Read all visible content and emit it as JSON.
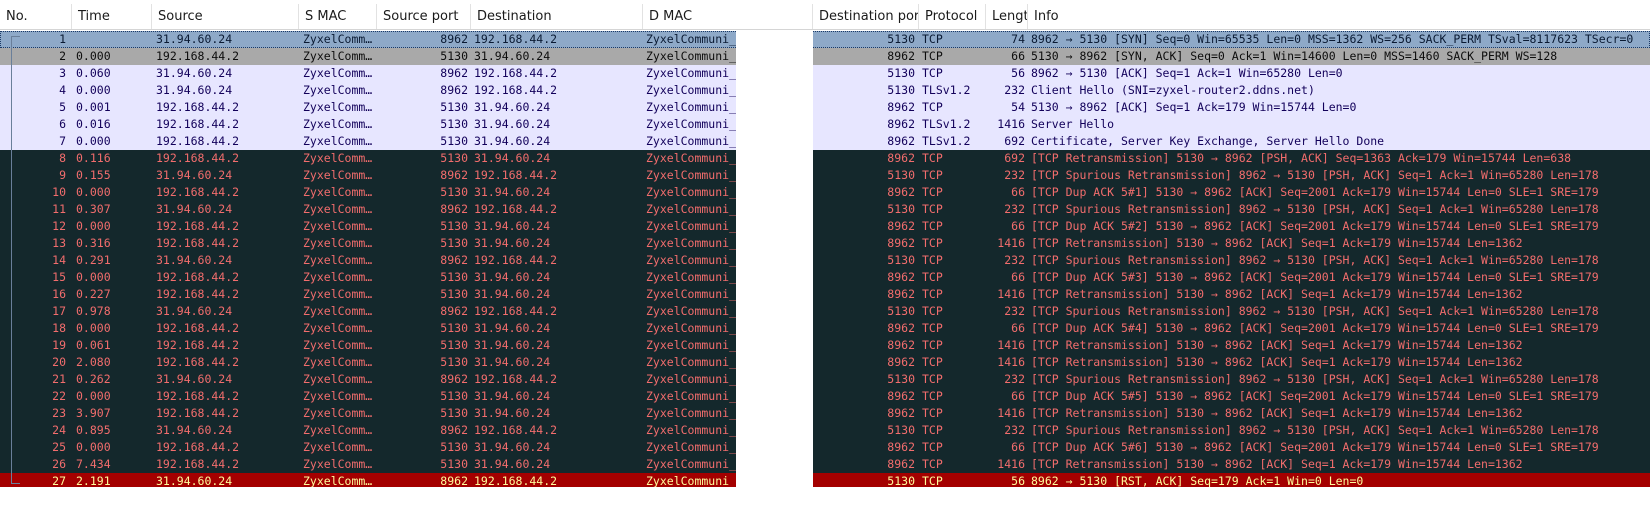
{
  "columns": [
    "No.",
    "Time",
    "Source",
    "S MAC",
    "Source port",
    "Destination",
    "D MAC",
    "Destination port",
    "Protocol",
    "Lengtl",
    "Info"
  ],
  "colors": {
    "selected_bg": "#8ea9c8",
    "selected_fg": "#0a1a33",
    "gray_bg": "#a9a9a9",
    "gray_fg": "#0d0d0d",
    "light_bg": "#e7e6ff",
    "light_fg": "#12005a",
    "dark_bg": "#14282c",
    "dark_fg": "#f26d6d",
    "rst_bg": "#a40000",
    "rst_fg": "#fffc9c"
  },
  "packets": [
    {
      "no": "1",
      "time": "",
      "src": "31.94.60.24",
      "smac": "ZyxelComm…",
      "sport": "8962",
      "dst": "192.168.44.2",
      "dmac": "ZyxelCommuni_",
      "dport": "5130",
      "proto": "TCP",
      "len": "74",
      "info": "8962 → 5130 [SYN] Seq=0 Win=65535 Len=0 MSS=1362 WS=256 SACK_PERM TSval=8117623 TSecr=0",
      "style": "selected"
    },
    {
      "no": "2",
      "time": "0.000",
      "src": "192.168.44.2",
      "smac": "ZyxelComm…",
      "sport": "5130",
      "dst": "31.94.60.24",
      "dmac": "ZyxelCommuni_",
      "dport": "8962",
      "proto": "TCP",
      "len": "66",
      "info": "5130 → 8962 [SYN, ACK] Seq=0 Ack=1 Win=14600 Len=0 MSS=1460 SACK_PERM WS=128",
      "style": "gray"
    },
    {
      "no": "3",
      "time": "0.060",
      "src": "31.94.60.24",
      "smac": "ZyxelComm…",
      "sport": "8962",
      "dst": "192.168.44.2",
      "dmac": "ZyxelCommuni_",
      "dport": "5130",
      "proto": "TCP",
      "len": "56",
      "info": "8962 → 5130 [ACK] Seq=1 Ack=1 Win=65280 Len=0",
      "style": "light"
    },
    {
      "no": "4",
      "time": "0.000",
      "src": "31.94.60.24",
      "smac": "ZyxelComm…",
      "sport": "8962",
      "dst": "192.168.44.2",
      "dmac": "ZyxelCommuni_",
      "dport": "5130",
      "proto": "TLSv1.2",
      "len": "232",
      "info": "Client Hello (SNI=zyxel-router2.ddns.net)",
      "style": "light"
    },
    {
      "no": "5",
      "time": "0.001",
      "src": "192.168.44.2",
      "smac": "ZyxelComm…",
      "sport": "5130",
      "dst": "31.94.60.24",
      "dmac": "ZyxelCommuni_",
      "dport": "8962",
      "proto": "TCP",
      "len": "54",
      "info": "5130 → 8962 [ACK] Seq=1 Ack=179 Win=15744 Len=0",
      "style": "light"
    },
    {
      "no": "6",
      "time": "0.016",
      "src": "192.168.44.2",
      "smac": "ZyxelComm…",
      "sport": "5130",
      "dst": "31.94.60.24",
      "dmac": "ZyxelCommuni_",
      "dport": "8962",
      "proto": "TLSv1.2",
      "len": "1416",
      "info": "Server Hello",
      "style": "light"
    },
    {
      "no": "7",
      "time": "0.000",
      "src": "192.168.44.2",
      "smac": "ZyxelComm…",
      "sport": "5130",
      "dst": "31.94.60.24",
      "dmac": "ZyxelCommuni_",
      "dport": "8962",
      "proto": "TLSv1.2",
      "len": "692",
      "info": "Certificate, Server Key Exchange, Server Hello Done",
      "style": "light"
    },
    {
      "no": "8",
      "time": "0.116",
      "src": "192.168.44.2",
      "smac": "ZyxelComm…",
      "sport": "5130",
      "dst": "31.94.60.24",
      "dmac": "ZyxelCommuni_",
      "dport": "8962",
      "proto": "TCP",
      "len": "692",
      "info": "[TCP Retransmission] 5130 → 8962 [PSH, ACK] Seq=1363 Ack=179 Win=15744 Len=638",
      "style": "dark"
    },
    {
      "no": "9",
      "time": "0.155",
      "src": "31.94.60.24",
      "smac": "ZyxelComm…",
      "sport": "8962",
      "dst": "192.168.44.2",
      "dmac": "ZyxelCommuni_",
      "dport": "5130",
      "proto": "TCP",
      "len": "232",
      "info": "[TCP Spurious Retransmission] 8962 → 5130 [PSH, ACK] Seq=1 Ack=1 Win=65280 Len=178",
      "style": "dark"
    },
    {
      "no": "10",
      "time": "0.000",
      "src": "192.168.44.2",
      "smac": "ZyxelComm…",
      "sport": "5130",
      "dst": "31.94.60.24",
      "dmac": "ZyxelCommuni_",
      "dport": "8962",
      "proto": "TCP",
      "len": "66",
      "info": "[TCP Dup ACK 5#1] 5130 → 8962 [ACK] Seq=2001 Ack=179 Win=15744 Len=0 SLE=1 SRE=179",
      "style": "dark"
    },
    {
      "no": "11",
      "time": "0.307",
      "src": "31.94.60.24",
      "smac": "ZyxelComm…",
      "sport": "8962",
      "dst": "192.168.44.2",
      "dmac": "ZyxelCommuni_",
      "dport": "5130",
      "proto": "TCP",
      "len": "232",
      "info": "[TCP Spurious Retransmission] 8962 → 5130 [PSH, ACK] Seq=1 Ack=1 Win=65280 Len=178",
      "style": "dark"
    },
    {
      "no": "12",
      "time": "0.000",
      "src": "192.168.44.2",
      "smac": "ZyxelComm…",
      "sport": "5130",
      "dst": "31.94.60.24",
      "dmac": "ZyxelCommuni_",
      "dport": "8962",
      "proto": "TCP",
      "len": "66",
      "info": "[TCP Dup ACK 5#2] 5130 → 8962 [ACK] Seq=2001 Ack=179 Win=15744 Len=0 SLE=1 SRE=179",
      "style": "dark"
    },
    {
      "no": "13",
      "time": "0.316",
      "src": "192.168.44.2",
      "smac": "ZyxelComm…",
      "sport": "5130",
      "dst": "31.94.60.24",
      "dmac": "ZyxelCommuni_",
      "dport": "8962",
      "proto": "TCP",
      "len": "1416",
      "info": "[TCP Retransmission] 5130 → 8962 [ACK] Seq=1 Ack=179 Win=15744 Len=1362",
      "style": "dark"
    },
    {
      "no": "14",
      "time": "0.291",
      "src": "31.94.60.24",
      "smac": "ZyxelComm…",
      "sport": "8962",
      "dst": "192.168.44.2",
      "dmac": "ZyxelCommuni_",
      "dport": "5130",
      "proto": "TCP",
      "len": "232",
      "info": "[TCP Spurious Retransmission] 8962 → 5130 [PSH, ACK] Seq=1 Ack=1 Win=65280 Len=178",
      "style": "dark"
    },
    {
      "no": "15",
      "time": "0.000",
      "src": "192.168.44.2",
      "smac": "ZyxelComm…",
      "sport": "5130",
      "dst": "31.94.60.24",
      "dmac": "ZyxelCommuni_",
      "dport": "8962",
      "proto": "TCP",
      "len": "66",
      "info": "[TCP Dup ACK 5#3] 5130 → 8962 [ACK] Seq=2001 Ack=179 Win=15744 Len=0 SLE=1 SRE=179",
      "style": "dark"
    },
    {
      "no": "16",
      "time": "0.227",
      "src": "192.168.44.2",
      "smac": "ZyxelComm…",
      "sport": "5130",
      "dst": "31.94.60.24",
      "dmac": "ZyxelCommuni_",
      "dport": "8962",
      "proto": "TCP",
      "len": "1416",
      "info": "[TCP Retransmission] 5130 → 8962 [ACK] Seq=1 Ack=179 Win=15744 Len=1362",
      "style": "dark"
    },
    {
      "no": "17",
      "time": "0.978",
      "src": "31.94.60.24",
      "smac": "ZyxelComm…",
      "sport": "8962",
      "dst": "192.168.44.2",
      "dmac": "ZyxelCommuni_",
      "dport": "5130",
      "proto": "TCP",
      "len": "232",
      "info": "[TCP Spurious Retransmission] 8962 → 5130 [PSH, ACK] Seq=1 Ack=1 Win=65280 Len=178",
      "style": "dark"
    },
    {
      "no": "18",
      "time": "0.000",
      "src": "192.168.44.2",
      "smac": "ZyxelComm…",
      "sport": "5130",
      "dst": "31.94.60.24",
      "dmac": "ZyxelCommuni_",
      "dport": "8962",
      "proto": "TCP",
      "len": "66",
      "info": "[TCP Dup ACK 5#4] 5130 → 8962 [ACK] Seq=2001 Ack=179 Win=15744 Len=0 SLE=1 SRE=179",
      "style": "dark"
    },
    {
      "no": "19",
      "time": "0.061",
      "src": "192.168.44.2",
      "smac": "ZyxelComm…",
      "sport": "5130",
      "dst": "31.94.60.24",
      "dmac": "ZyxelCommuni_",
      "dport": "8962",
      "proto": "TCP",
      "len": "1416",
      "info": "[TCP Retransmission] 5130 → 8962 [ACK] Seq=1 Ack=179 Win=15744 Len=1362",
      "style": "dark"
    },
    {
      "no": "20",
      "time": "2.080",
      "src": "192.168.44.2",
      "smac": "ZyxelComm…",
      "sport": "5130",
      "dst": "31.94.60.24",
      "dmac": "ZyxelCommuni_",
      "dport": "8962",
      "proto": "TCP",
      "len": "1416",
      "info": "[TCP Retransmission] 5130 → 8962 [ACK] Seq=1 Ack=179 Win=15744 Len=1362",
      "style": "dark"
    },
    {
      "no": "21",
      "time": "0.262",
      "src": "31.94.60.24",
      "smac": "ZyxelComm…",
      "sport": "8962",
      "dst": "192.168.44.2",
      "dmac": "ZyxelCommuni_",
      "dport": "5130",
      "proto": "TCP",
      "len": "232",
      "info": "[TCP Spurious Retransmission] 8962 → 5130 [PSH, ACK] Seq=1 Ack=1 Win=65280 Len=178",
      "style": "dark"
    },
    {
      "no": "22",
      "time": "0.000",
      "src": "192.168.44.2",
      "smac": "ZyxelComm…",
      "sport": "5130",
      "dst": "31.94.60.24",
      "dmac": "ZyxelCommuni_",
      "dport": "8962",
      "proto": "TCP",
      "len": "66",
      "info": "[TCP Dup ACK 5#5] 5130 → 8962 [ACK] Seq=2001 Ack=179 Win=15744 Len=0 SLE=1 SRE=179",
      "style": "dark"
    },
    {
      "no": "23",
      "time": "3.907",
      "src": "192.168.44.2",
      "smac": "ZyxelComm…",
      "sport": "5130",
      "dst": "31.94.60.24",
      "dmac": "ZyxelCommuni_",
      "dport": "8962",
      "proto": "TCP",
      "len": "1416",
      "info": "[TCP Retransmission] 5130 → 8962 [ACK] Seq=1 Ack=179 Win=15744 Len=1362",
      "style": "dark"
    },
    {
      "no": "24",
      "time": "0.895",
      "src": "31.94.60.24",
      "smac": "ZyxelComm…",
      "sport": "8962",
      "dst": "192.168.44.2",
      "dmac": "ZyxelCommuni_",
      "dport": "5130",
      "proto": "TCP",
      "len": "232",
      "info": "[TCP Spurious Retransmission] 8962 → 5130 [PSH, ACK] Seq=1 Ack=1 Win=65280 Len=178",
      "style": "dark"
    },
    {
      "no": "25",
      "time": "0.000",
      "src": "192.168.44.2",
      "smac": "ZyxelComm…",
      "sport": "5130",
      "dst": "31.94.60.24",
      "dmac": "ZyxelCommuni_",
      "dport": "8962",
      "proto": "TCP",
      "len": "66",
      "info": "[TCP Dup ACK 5#6] 5130 → 8962 [ACK] Seq=2001 Ack=179 Win=15744 Len=0 SLE=1 SRE=179",
      "style": "dark"
    },
    {
      "no": "26",
      "time": "7.434",
      "src": "192.168.44.2",
      "smac": "ZyxelComm…",
      "sport": "5130",
      "dst": "31.94.60.24",
      "dmac": "ZyxelCommuni_",
      "dport": "8962",
      "proto": "TCP",
      "len": "1416",
      "info": "[TCP Retransmission] 5130 → 8962 [ACK] Seq=1 Ack=179 Win=15744 Len=1362",
      "style": "dark"
    },
    {
      "no": "27",
      "time": "2.191",
      "src": "31.94.60.24",
      "smac": "ZyxelComm…",
      "sport": "8962",
      "dst": "192.168.44.2",
      "dmac": "ZyxelCommuni_",
      "dport": "5130",
      "proto": "TCP",
      "len": "56",
      "info": "8962 → 5130 [RST, ACK] Seq=179 Ack=1 Win=0 Len=0",
      "style": "rst"
    }
  ]
}
